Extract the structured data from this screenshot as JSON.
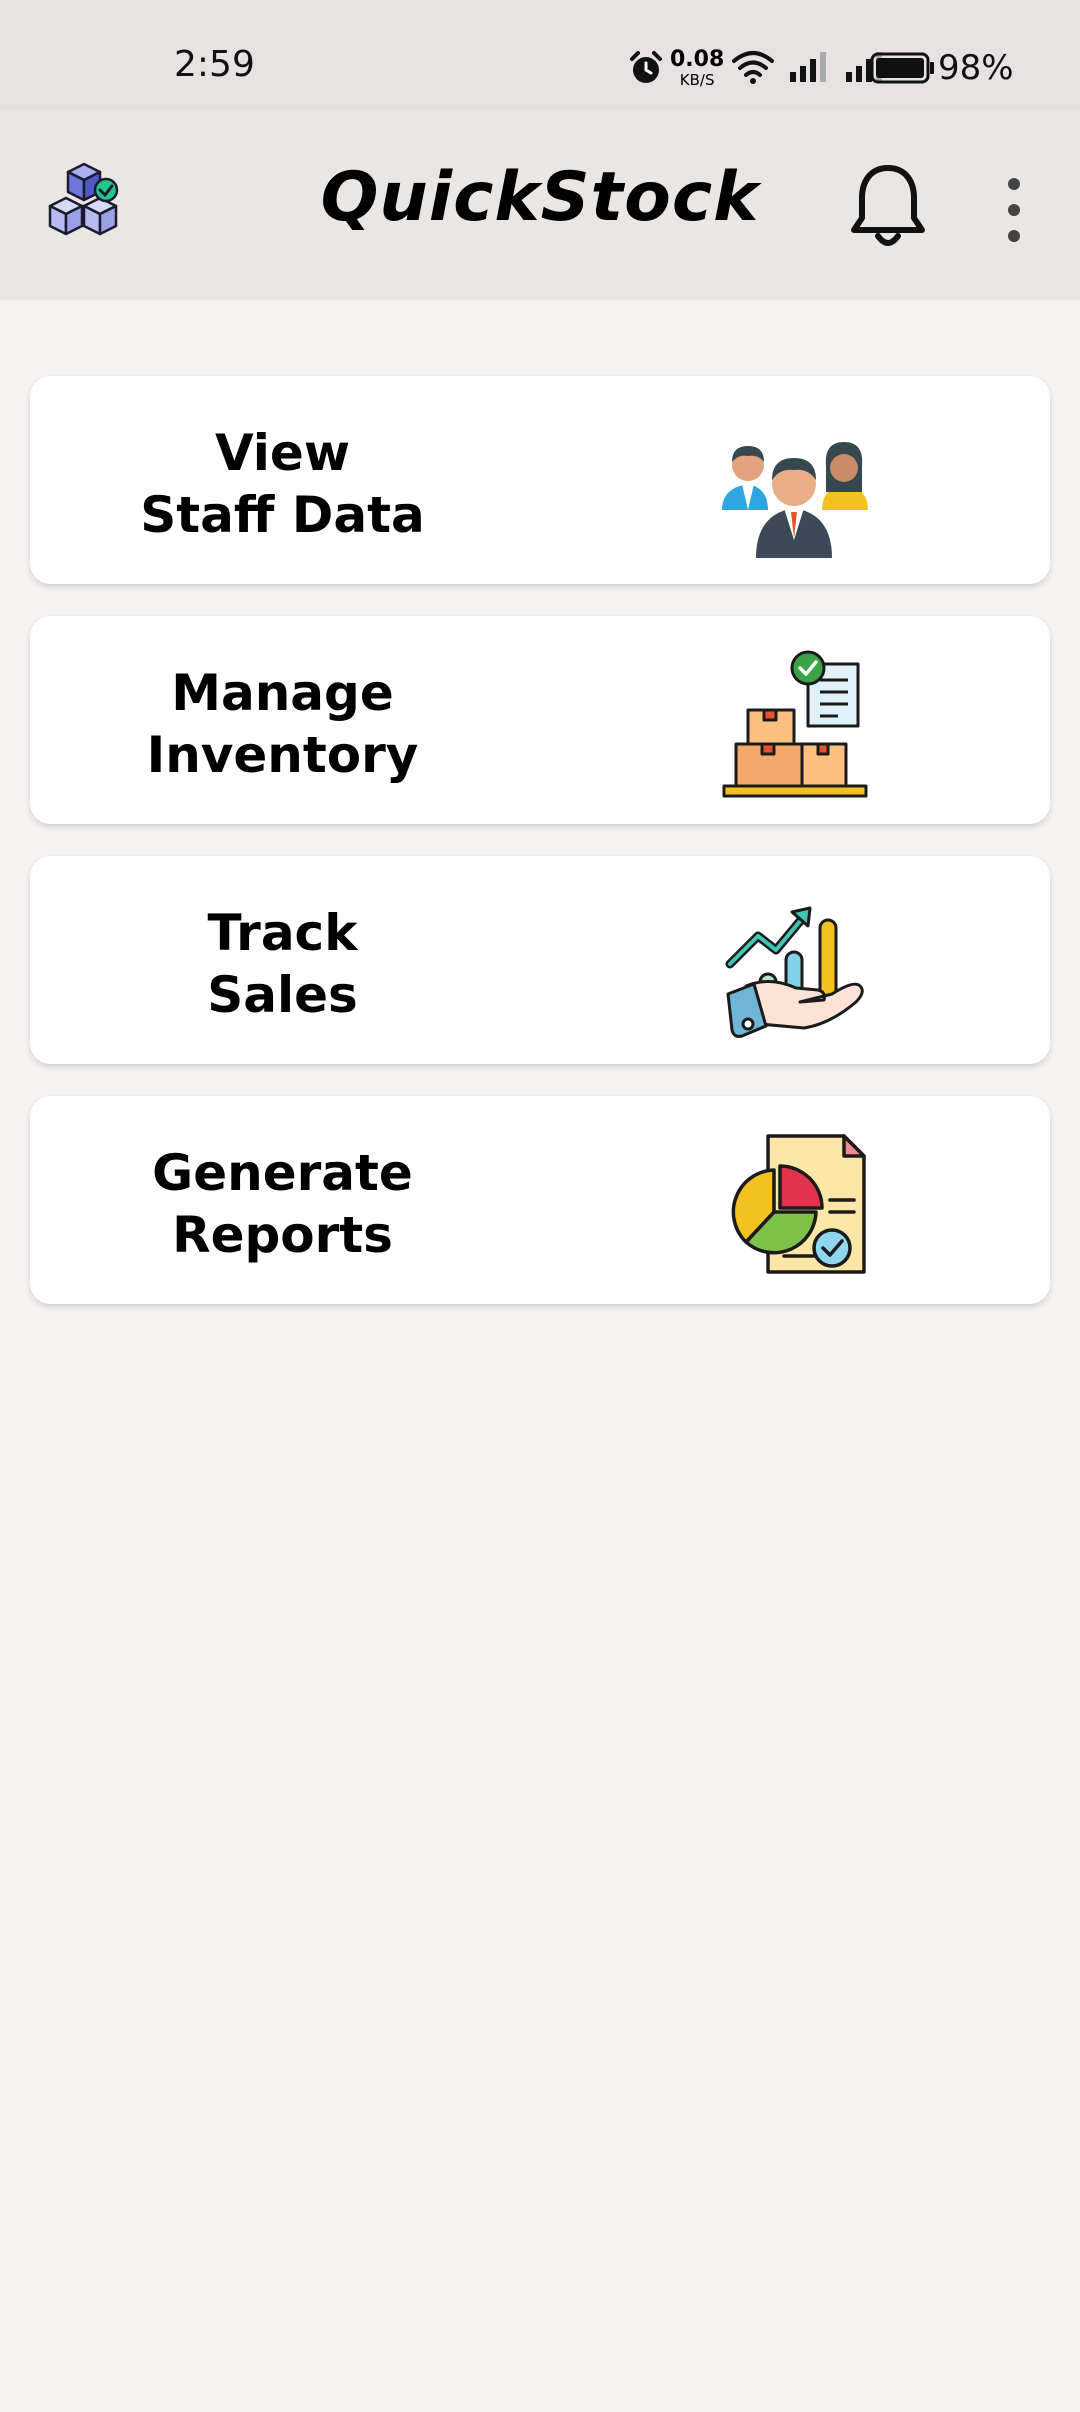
{
  "status": {
    "time": "2:59",
    "net_speed": "0.08",
    "net_unit": "KB/S",
    "battery": "98%"
  },
  "appbar": {
    "title": "QuickStock",
    "icons": [
      "app-logo-cubes-icon",
      "bell-icon",
      "more-vert-icon"
    ]
  },
  "cards": [
    {
      "label": "View\nStaff Data",
      "icon": "staff-people-icon"
    },
    {
      "label": "Manage\nInventory",
      "icon": "inventory-boxes-icon"
    },
    {
      "label": "Track\nSales",
      "icon": "sales-growth-icon"
    },
    {
      "label": "Generate\nReports",
      "icon": "report-chart-icon"
    }
  ],
  "colors": {
    "background": "#f5f2f1",
    "appbar": "#eae6e4",
    "statusbar": "#e7e2e1",
    "card": "#ffffff"
  }
}
